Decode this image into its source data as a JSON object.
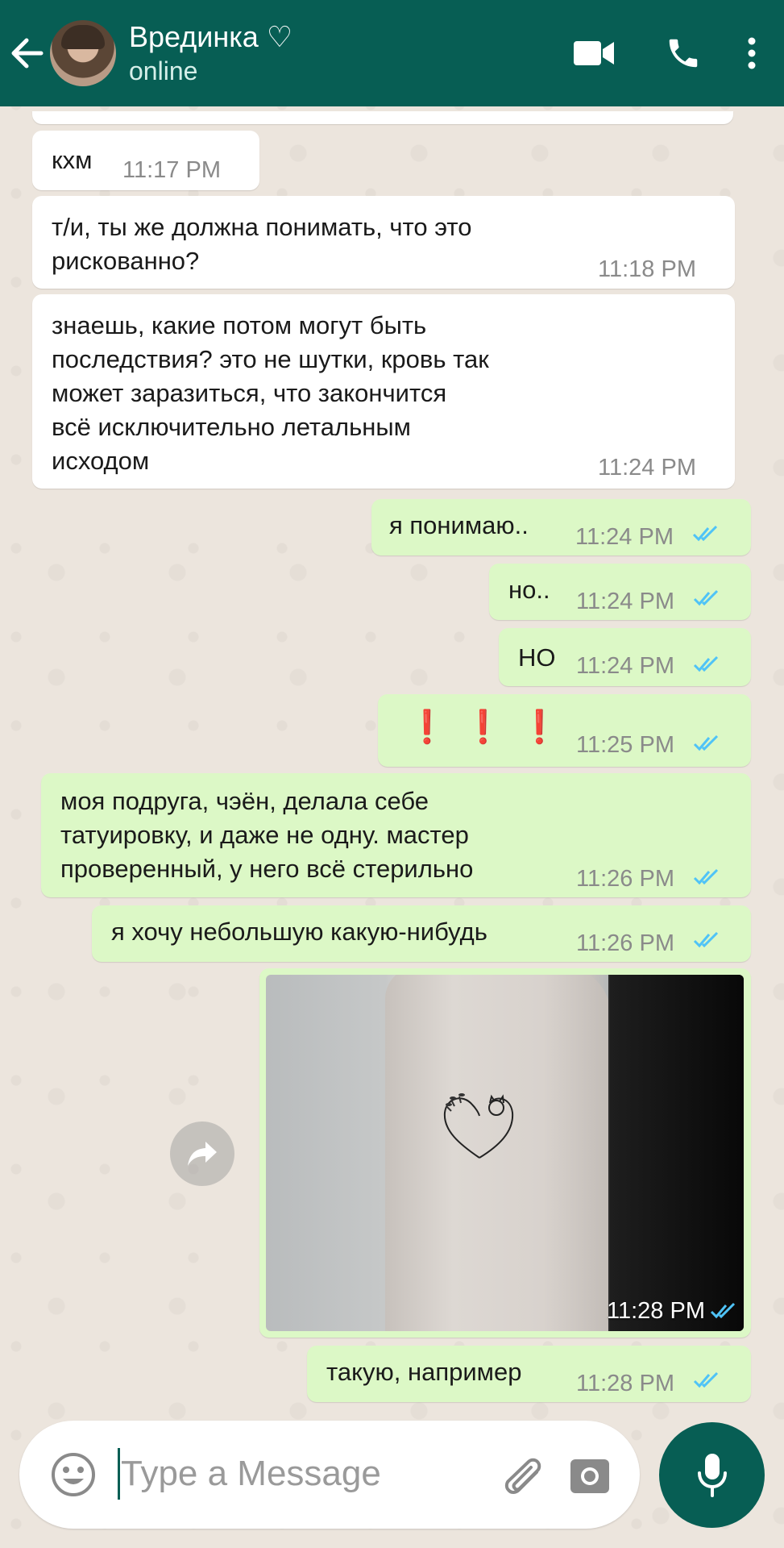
{
  "header": {
    "contact_name": "Врединка ♡",
    "status": "online"
  },
  "messages": [
    {
      "dir": "in",
      "text": "кхм",
      "time": "11:17 PM"
    },
    {
      "dir": "in",
      "text": "т/и, ты же должна понимать, что это\nрискованно?",
      "time": "11:18 PM"
    },
    {
      "dir": "in",
      "text": "знаешь, какие потом могут быть\nпоследствия? это не шутки, кровь так\nможет заразиться, что закончится\nвсё исключительно летальным\nисходом",
      "time": "11:24 PM"
    },
    {
      "dir": "out",
      "text": "я понимаю..",
      "time": "11:24 PM"
    },
    {
      "dir": "out",
      "text": "но..",
      "time": "11:24 PM"
    },
    {
      "dir": "out",
      "text": "НО",
      "time": "11:24 PM"
    },
    {
      "dir": "out",
      "text": "❗❗❗",
      "time": "11:25 PM"
    },
    {
      "dir": "out",
      "text": "моя подруга, чэён, делала себе\nтатуировку, и даже не одну. мастер\nпроверенный, у него всё стерильно",
      "time": "11:26 PM"
    },
    {
      "dir": "out",
      "text": "я хочу небольшую какую-нибудь",
      "time": "11:26 PM"
    },
    {
      "dir": "out",
      "type": "image",
      "time": "11:28 PM"
    },
    {
      "dir": "out",
      "text": "такую, например",
      "time": "11:28 PM"
    }
  ],
  "input": {
    "placeholder": "Type a Message"
  },
  "colors": {
    "header": "#075e54",
    "outgoing_bubble": "#dcf8c6",
    "incoming_bubble": "#ffffff",
    "read_ticks": "#4fc3f7",
    "exclamation": "#d81b1b"
  }
}
